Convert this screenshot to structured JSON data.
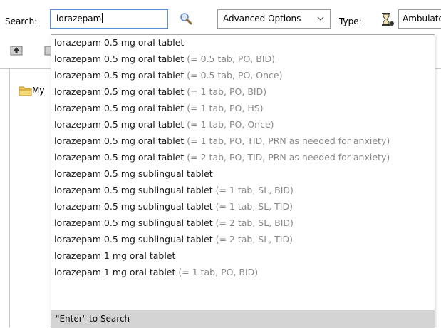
{
  "search": {
    "label": "Search:",
    "value": "lorazepam"
  },
  "advanced_options": {
    "label": "Advanced Options"
  },
  "type_filter": {
    "label": "Type:",
    "value": "Ambulatory"
  },
  "tree": {
    "root_label": "My"
  },
  "dropdown": {
    "results": [
      {
        "name": "lorazepam 0.5 mg oral tablet",
        "sig": ""
      },
      {
        "name": "lorazepam 0.5 mg oral tablet",
        "sig": "(= 0.5 tab, PO, BID)"
      },
      {
        "name": "lorazepam 0.5 mg oral tablet",
        "sig": "(= 0.5 tab, PO, Once)"
      },
      {
        "name": "lorazepam 0.5 mg oral tablet",
        "sig": "(= 1 tab, PO, BID)"
      },
      {
        "name": "lorazepam 0.5 mg oral tablet",
        "sig": "(= 1 tab, PO, HS)"
      },
      {
        "name": "lorazepam 0.5 mg oral tablet",
        "sig": "(= 1 tab, PO, Once)"
      },
      {
        "name": "lorazepam 0.5 mg oral tablet",
        "sig": "(= 1 tab, PO, TID, PRN as needed for anxiety)"
      },
      {
        "name": "lorazepam 0.5 mg oral tablet",
        "sig": "(= 2 tab, PO, TID, PRN as needed for anxiety)"
      },
      {
        "name": "lorazepam 0.5 mg sublingual tablet",
        "sig": ""
      },
      {
        "name": "lorazepam 0.5 mg sublingual tablet",
        "sig": "(= 1 tab, SL, BID)"
      },
      {
        "name": "lorazepam 0.5 mg sublingual tablet",
        "sig": "(= 1 tab, SL, TID)"
      },
      {
        "name": "lorazepam 0.5 mg sublingual tablet",
        "sig": "(= 2 tab, SL, BID)"
      },
      {
        "name": "lorazepam 0.5 mg sublingual tablet",
        "sig": "(= 2 tab, SL, TID)"
      },
      {
        "name": "lorazepam 1 mg oral tablet",
        "sig": ""
      },
      {
        "name": "lorazepam 1 mg oral tablet",
        "sig": "(= 1 tab, PO, BID)"
      }
    ],
    "footer": "\"Enter\" to Search"
  },
  "icons": {
    "search_button": "magnifier-icon",
    "type": "hourglass-icon",
    "up_folder": "up-folder-icon",
    "tree_folder": "folder-icon",
    "chevron": "chevron-down-icon"
  },
  "colors": {
    "input_border": "#5b8fd6",
    "sig_text": "#888888",
    "footer_bg": "#d4d4d4",
    "folder": "#f2cd5c"
  }
}
